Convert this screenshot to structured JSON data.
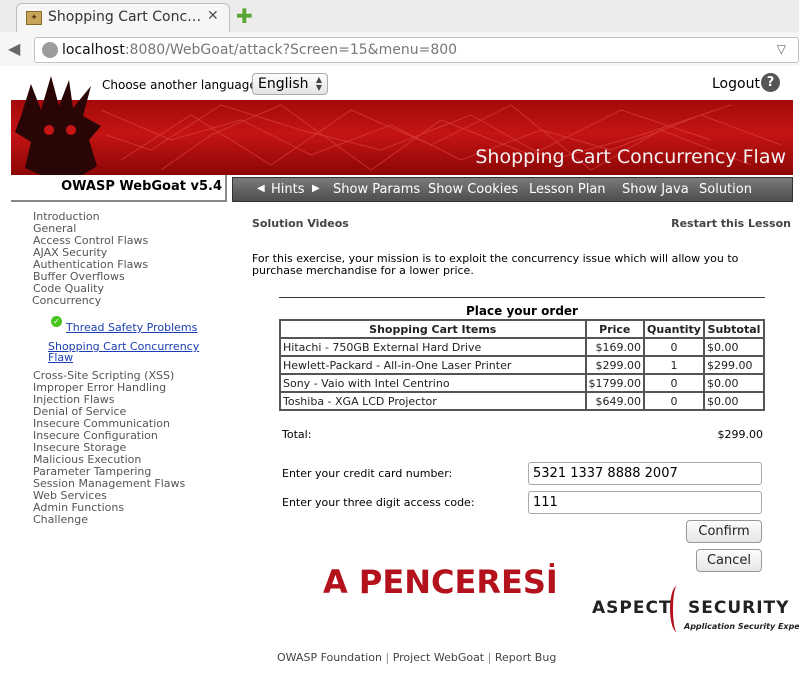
{
  "browser": {
    "tab_title": "Shopping Cart Conc…",
    "tab_close": "✕",
    "new_tab": "✚",
    "url_host": "localhost",
    "url_rest": ":8080/WebGoat/attack?Screen=15&menu=800"
  },
  "header": {
    "language_label": "Choose another language:",
    "language_value": "English",
    "logout": "Logout",
    "help": "?",
    "banner_title": "Shopping Cart Concurrency Flaw",
    "brand": "OWASP WebGoat  v5.4"
  },
  "menu": {
    "hints": "Hints",
    "show_params": "Show Params",
    "show_cookies": "Show Cookies",
    "lesson_plan": "Lesson Plan",
    "show_java": "Show Java",
    "solution": "Solution"
  },
  "sidebar": {
    "top_items": [
      "Introduction",
      "General",
      "Access Control Flaws",
      "AJAX Security",
      "Authentication Flaws",
      "Buffer Overflows",
      "Code Quality",
      "Concurrency"
    ],
    "sub_link_1": "Thread Safety Problems",
    "sub_link_2_line1": "Shopping Cart Concurrency",
    "sub_link_2_line2": "Flaw",
    "bottom_items": [
      "Cross-Site Scripting (XSS)",
      "Improper Error Handling",
      "Injection Flaws",
      "Denial of Service",
      "Insecure Communication",
      "Insecure Configuration",
      "Insecure Storage",
      "Malicious Execution",
      "Parameter Tampering",
      "Session Management Flaws",
      "Web Services",
      "Admin Functions",
      "Challenge"
    ]
  },
  "content": {
    "solution_videos": "Solution Videos",
    "restart": "Restart this Lesson",
    "intro": "For this exercise, your mission is to exploit the concurrency issue which will allow you to purchase merchandise for a lower price.",
    "order_title": "Place your order",
    "columns": [
      "Shopping Cart Items",
      "Price",
      "Quantity",
      "Subtotal"
    ],
    "rows": [
      {
        "item": "Hitachi - 750GB External Hard Drive",
        "price": "$169.00",
        "qty": "0",
        "subtotal": "$0.00"
      },
      {
        "item": "Hewlett-Packard - All-in-One Laser Printer",
        "price": "$299.00",
        "qty": "1",
        "subtotal": "$299.00"
      },
      {
        "item": "Sony - Vaio with Intel Centrino",
        "price": "$1799.00",
        "qty": "0",
        "subtotal": "$0.00"
      },
      {
        "item": "Toshiba - XGA LCD Projector",
        "price": "$649.00",
        "qty": "0",
        "subtotal": "$0.00"
      }
    ],
    "total_label": "Total:",
    "total_value": "$299.00",
    "cc_label": "Enter your credit card number:",
    "cc_value": "5321 1337 8888 2007",
    "code_label": "Enter your three digit access code:",
    "code_value": "111",
    "confirm": "Confirm",
    "cancel": "Cancel"
  },
  "watermark": "A PENCERESİ",
  "aspect": {
    "word1": "ASPECT",
    "word2": "SECURITY",
    "tagline": "Application Security Experts"
  },
  "footer": {
    "link1": "OWASP Foundation",
    "link2": "Project WebGoat",
    "link3": "Report Bug",
    "separator": "|"
  },
  "colors": {
    "banner_red": "#c41414",
    "watermark_red": "#b3121c",
    "link_blue": "#1a3fb4",
    "menu_gray": "#5e5e5e"
  }
}
